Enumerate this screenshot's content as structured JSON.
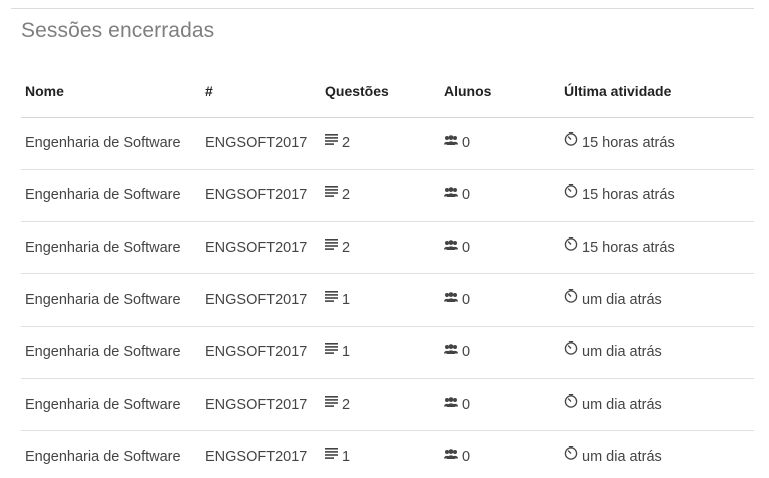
{
  "section": {
    "title": "Sessões encerradas"
  },
  "table": {
    "columns": [
      "Nome",
      "#",
      "Questões",
      "Alunos",
      "Última atividade"
    ],
    "rows": [
      {
        "name": "Engenharia de Software",
        "code": "ENGSOFT2017",
        "questions": "2",
        "students": "0",
        "activity": "15 horas atrás",
        "activity_icon": "timer-icon"
      },
      {
        "name": "Engenharia de Software",
        "code": "ENGSOFT2017",
        "questions": "2",
        "students": "0",
        "activity": "15 horas atrás",
        "activity_icon": "timer-icon"
      },
      {
        "name": "Engenharia de Software",
        "code": "ENGSOFT2017",
        "questions": "2",
        "students": "0",
        "activity": "15 horas atrás",
        "activity_icon": "timer-icon"
      },
      {
        "name": "Engenharia de Software",
        "code": "ENGSOFT2017",
        "questions": "1",
        "students": "0",
        "activity": "um dia atrás",
        "activity_icon": "timer-icon"
      },
      {
        "name": "Engenharia de Software",
        "code": "ENGSOFT2017",
        "questions": "1",
        "students": "0",
        "activity": "um dia atrás",
        "activity_icon": "timer-icon"
      },
      {
        "name": "Engenharia de Software",
        "code": "ENGSOFT2017",
        "questions": "2",
        "students": "0",
        "activity": "um dia atrás",
        "activity_icon": "timer-icon"
      },
      {
        "name": "Engenharia de Software",
        "code": "ENGSOFT2017",
        "questions": "1",
        "students": "0",
        "activity": "um dia atrás",
        "activity_icon": "timer-icon"
      }
    ]
  },
  "icons": {
    "questions": "list-icon",
    "students": "group-icon",
    "activity": "timer-icon"
  },
  "colors": {
    "title": "#7f7f7f",
    "header_text": "#222222",
    "cell_text": "#444444",
    "divider": "#e0e0e0"
  }
}
